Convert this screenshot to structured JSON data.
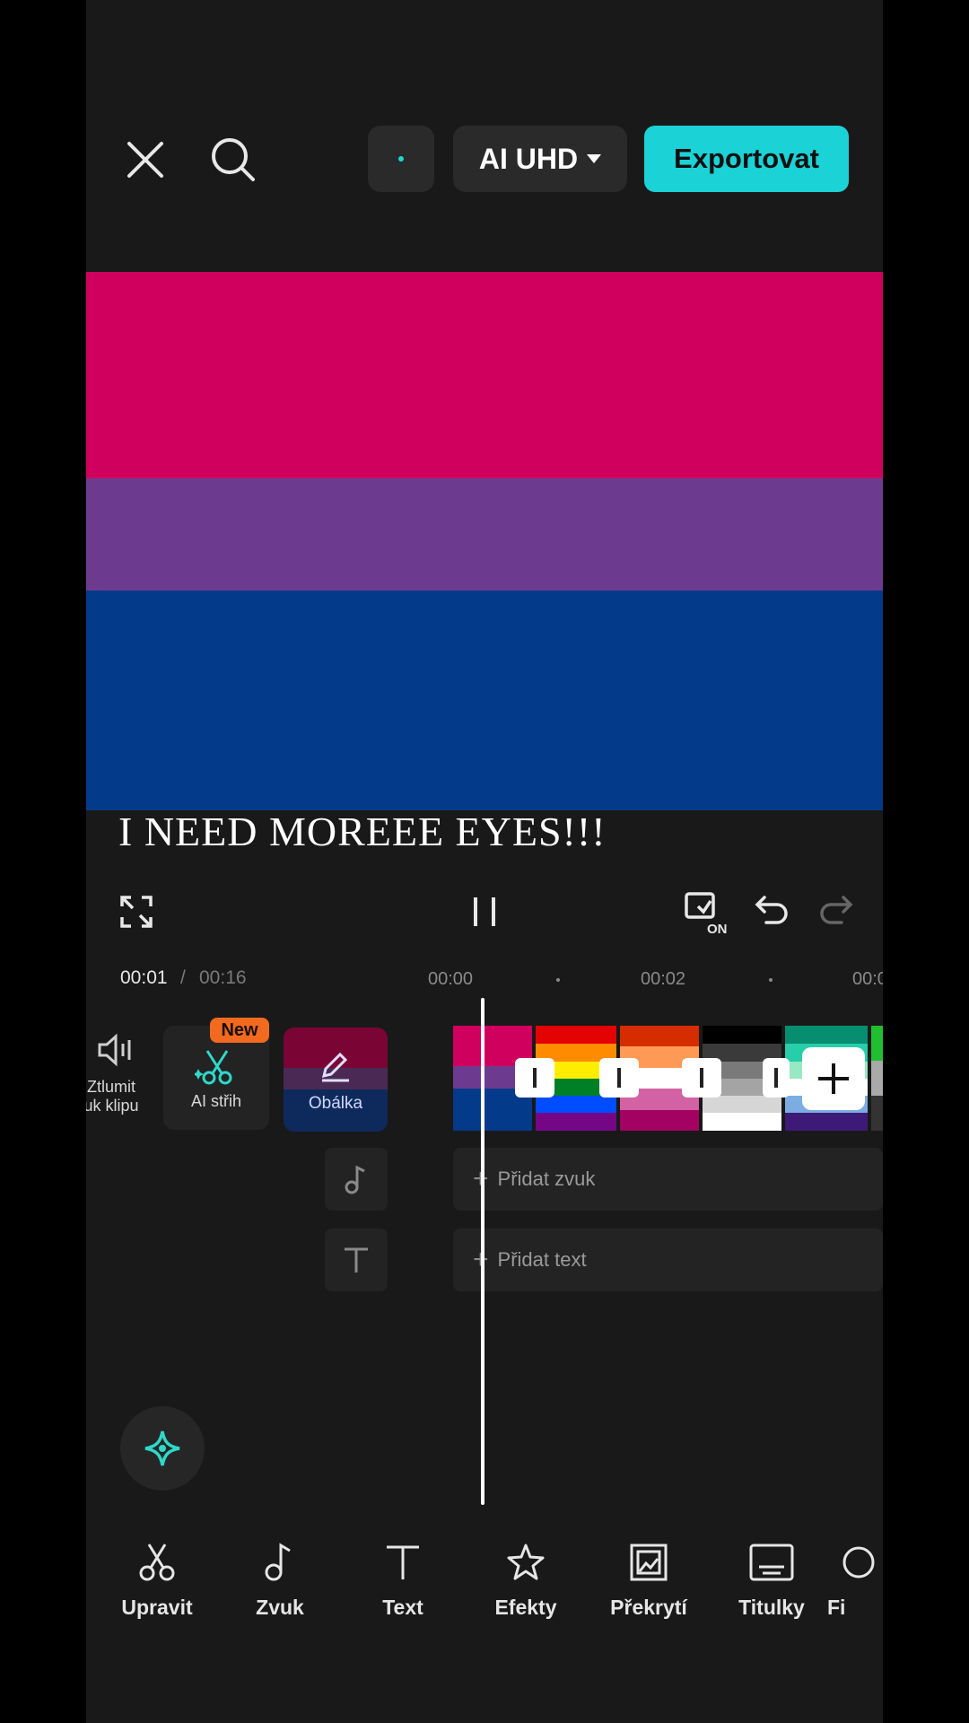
{
  "topbar": {
    "quality_label": "AI UHD",
    "export_label": "Exportovat"
  },
  "preview": {
    "caption": "I NEED MOREEE EYES!!!",
    "colors": {
      "pink": "#d0005e",
      "purple": "#6c3b8f",
      "blue": "#043a8a"
    }
  },
  "timeline": {
    "current_time": "00:01",
    "separator": "/",
    "total_time": "00:16",
    "ticks": [
      "00:00",
      "00:02",
      "00:0"
    ],
    "tools": {
      "mute_label": "Ztlumit\nzvuk klipu",
      "ai_label": "AI střih",
      "new_badge": "New",
      "cover_label": "Obálka"
    },
    "add_audio": "Přidat zvuk",
    "add_text": "Přidat text"
  },
  "toolbar": {
    "items": [
      {
        "label": "Upravit",
        "icon": "scissors-icon"
      },
      {
        "label": "Zvuk",
        "icon": "music-note-icon"
      },
      {
        "label": "Text",
        "icon": "text-icon"
      },
      {
        "label": "Efekty",
        "icon": "star-icon"
      },
      {
        "label": "Překrytí",
        "icon": "overlay-icon"
      },
      {
        "label": "Titulky",
        "icon": "captions-icon"
      },
      {
        "label": "Fi",
        "icon": "filter-icon"
      }
    ]
  },
  "accent_color": "#1bd2d6"
}
